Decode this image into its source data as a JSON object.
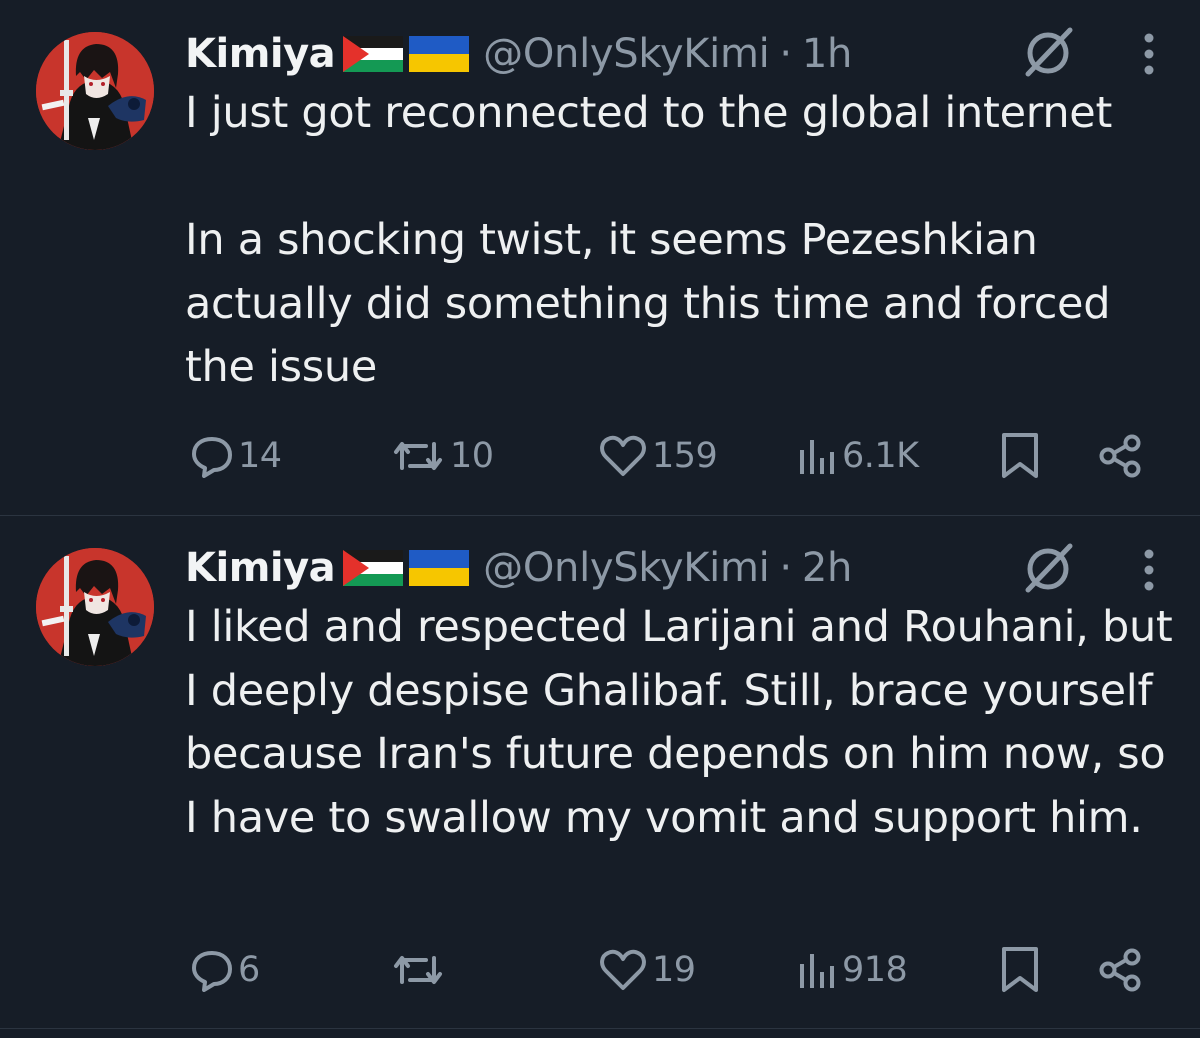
{
  "tweets": [
    {
      "display_name": "Kimiya",
      "flags": [
        "palestine-flag",
        "ukraine-flag"
      ],
      "handle": "@OnlySkyKimi",
      "time_separator": "·",
      "time": "1h",
      "paragraphs": [
        "I just got reconnected to the global internet",
        "In a shocking twist, it seems Pezeshkian actually did something this time and forced the issue"
      ],
      "replies": "14",
      "reposts": "10",
      "likes": "159",
      "views": "6.1K"
    },
    {
      "display_name": "Kimiya",
      "flags": [
        "palestine-flag",
        "ukraine-flag"
      ],
      "handle": "@OnlySkyKimi",
      "time_separator": "·",
      "time": "2h",
      "paragraphs": [
        "I liked and respected Larijani and Rouhani, but I deeply despise Ghalibaf. Still, brace yourself because Iran's future depends on him now, so I have to swallow my vomit and support him."
      ],
      "replies": "6",
      "reposts": "",
      "likes": "19",
      "views": "918"
    }
  ],
  "icons": {
    "reply": "speech-bubble-icon",
    "repost": "repost-arrows-icon",
    "like": "heart-icon",
    "views": "bar-chart-icon",
    "bookmark": "bookmark-icon",
    "share": "share-icon",
    "grok": "slashed-circle-icon",
    "more": "vertical-dots-icon"
  },
  "colors": {
    "background": "#161d27",
    "text": "#e7e9ea",
    "muted": "#8d99a6",
    "avatar_bg": "#c8352c"
  }
}
